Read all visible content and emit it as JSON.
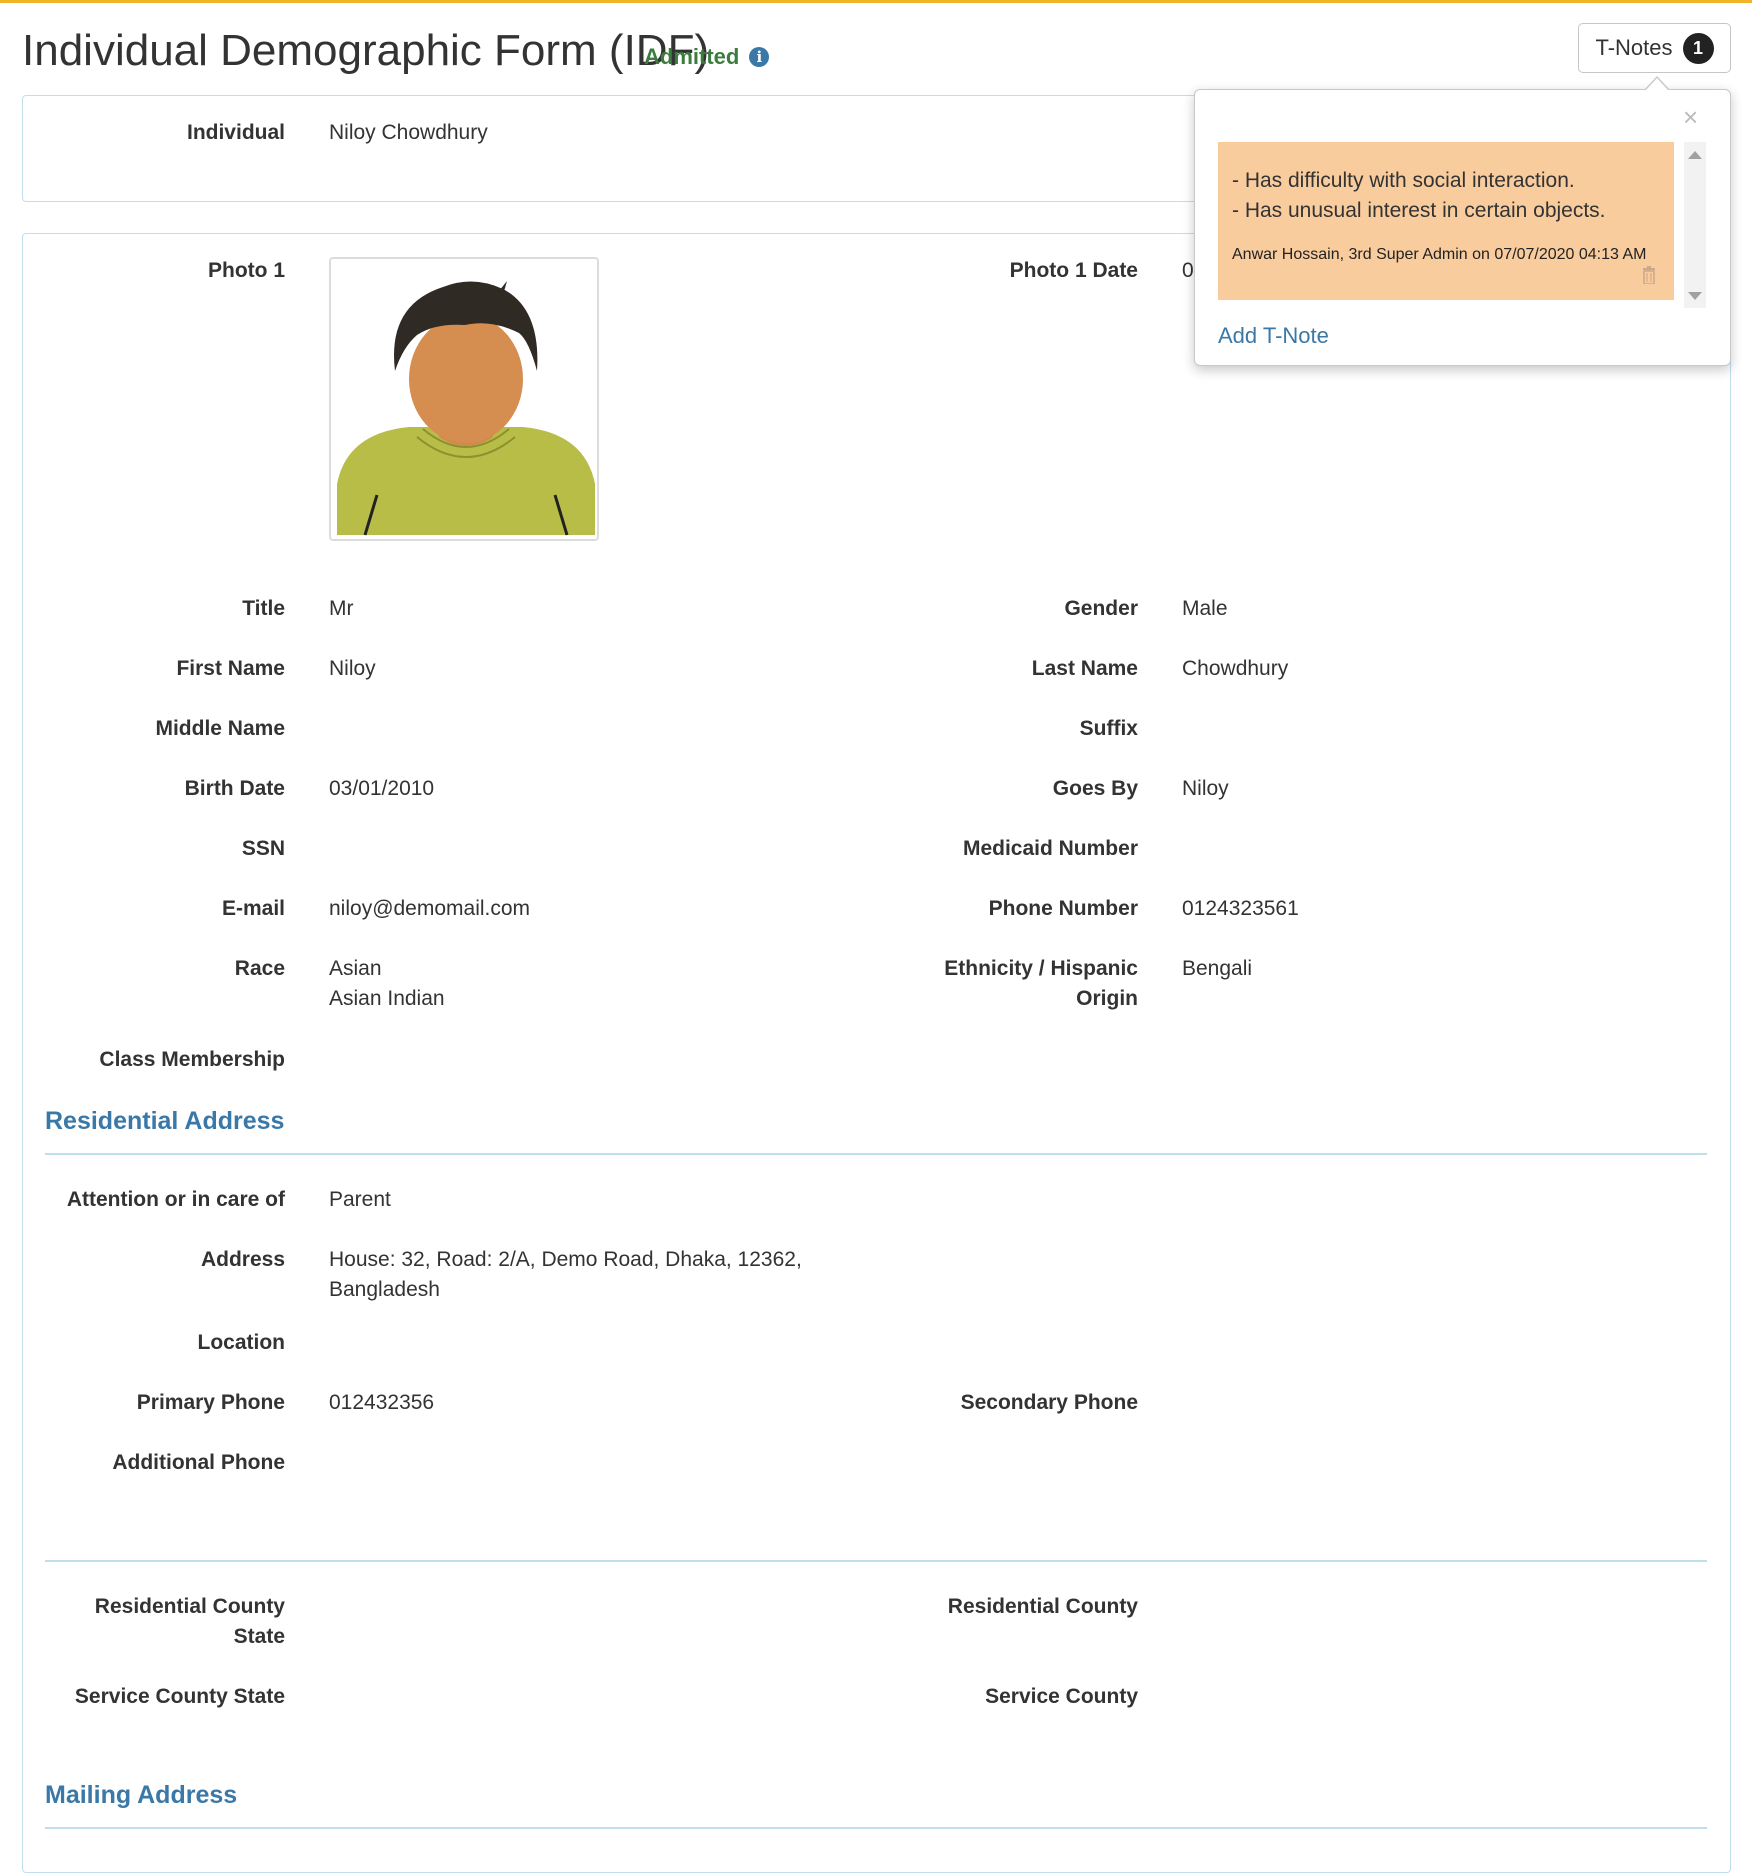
{
  "header": {
    "title": "Individual Demographic Form (IDF)",
    "status": "Admitted",
    "tnotes_label": "T-Notes",
    "tnotes_count": "1"
  },
  "tnote_popover": {
    "note_text": "- Has difficulty with social interaction.\n- Has unusual interest in certain objects.",
    "note_meta": "Anwar Hossain, 3rd Super Admin on 07/07/2020 04:13 AM",
    "add_label": "Add T-Note",
    "note_color": "#f9cc9e"
  },
  "individual": {
    "label": "Individual",
    "value": "Niloy Chowdhury"
  },
  "photo": {
    "label": "Photo 1",
    "date_label": "Photo 1 Date",
    "date_value": "0"
  },
  "fields": {
    "title": {
      "label": "Title",
      "value": "Mr"
    },
    "gender": {
      "label": "Gender",
      "value": "Male"
    },
    "first_name": {
      "label": "First Name",
      "value": "Niloy"
    },
    "last_name": {
      "label": "Last Name",
      "value": "Chowdhury"
    },
    "middle_name": {
      "label": "Middle Name",
      "value": ""
    },
    "suffix": {
      "label": "Suffix",
      "value": ""
    },
    "birth_date": {
      "label": "Birth Date",
      "value": "03/01/2010"
    },
    "goes_by": {
      "label": "Goes By",
      "value": "Niloy"
    },
    "ssn": {
      "label": "SSN",
      "value": ""
    },
    "medicaid": {
      "label": "Medicaid Number",
      "value": ""
    },
    "email": {
      "label": "E-mail",
      "value": "niloy@demomail.com"
    },
    "phone": {
      "label": "Phone Number",
      "value": "0124323561"
    },
    "race": {
      "label": "Race",
      "value": "Asian\nAsian Indian"
    },
    "ethnicity": {
      "label": "Ethnicity / Hispanic\nOrigin",
      "value": "Bengali"
    },
    "class_membership": {
      "label": "Class Membership",
      "value": ""
    }
  },
  "residential": {
    "heading": "Residential Address",
    "attention": {
      "label": "Attention or in care of",
      "value": "Parent"
    },
    "address": {
      "label": "Address",
      "value": "House: 32, Road: 2/A, Demo Road, Dhaka, 12362,\nBangladesh"
    },
    "location": {
      "label": "Location",
      "value": ""
    },
    "primary_phone": {
      "label": "Primary Phone",
      "value": "012432356"
    },
    "secondary_phone": {
      "label": "Secondary Phone",
      "value": ""
    },
    "additional_phone": {
      "label": "Additional Phone",
      "value": ""
    },
    "res_county_state": {
      "label": "Residential County\nState",
      "value": ""
    },
    "res_county": {
      "label": "Residential County",
      "value": ""
    },
    "svc_county_state": {
      "label": "Service County State",
      "value": ""
    },
    "svc_county": {
      "label": "Service County",
      "value": ""
    }
  },
  "mailing": {
    "heading": "Mailing Address"
  },
  "colors": {
    "accent": "#3a78a8",
    "status": "#3c7c3e",
    "border": "#bfdfec",
    "topline": "#f0b429"
  }
}
